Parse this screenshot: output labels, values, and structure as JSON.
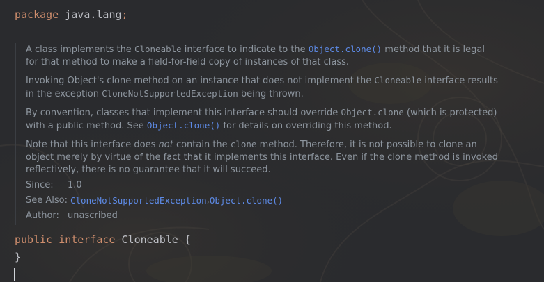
{
  "editor": {
    "package_keyword": "package",
    "package_name": "java.lang",
    "package_semicolon": ";",
    "public_keyword": "public",
    "interface_keyword": "interface",
    "class_name": "Cloneable",
    "open_brace": "{",
    "close_brace": "}"
  },
  "doc": {
    "p1": {
      "a": "A class implements the ",
      "b": "Cloneable",
      "c": " interface to indicate to the ",
      "d": "Object.clone()",
      "e": " method that it is legal for that method to make a field-for-field copy of instances of that class."
    },
    "p2": {
      "a": "Invoking Object's clone method on an instance that does not implement the ",
      "b": "Cloneable",
      "c": " interface results in the exception ",
      "d": "CloneNotSupportedException",
      "e": " being thrown."
    },
    "p3": {
      "a": "By convention, classes that implement this interface should override ",
      "b": "Object.clone",
      "c": " (which is protected) with a public method. See ",
      "d": "Object.clone()",
      "e": " for details on overriding this method."
    },
    "p4": {
      "a": "Note that this interface does ",
      "b": "not",
      "c": " contain the ",
      "d": "clone",
      "e": " method. Therefore, it is not possible to clone an object merely by virtue of the fact that it implements this interface. Even if the clone method is invoked reflectively, there is no guarantee that it will succeed."
    },
    "tags": {
      "since_label": "Since:",
      "since_value": "1.0",
      "see_also_label": "See Also:",
      "see_also_link1": "CloneNotSupportedException",
      "see_also_sep": ", ",
      "see_also_link2": "Object.clone()",
      "author_label": "Author:",
      "author_value": "unascribed"
    }
  },
  "colors": {
    "background": "#2a2b2e",
    "keyword": "#cf8e6d",
    "identifier": "#bcbec4",
    "doc_text": "#8d959e",
    "doc_link": "#5d8ae5"
  }
}
